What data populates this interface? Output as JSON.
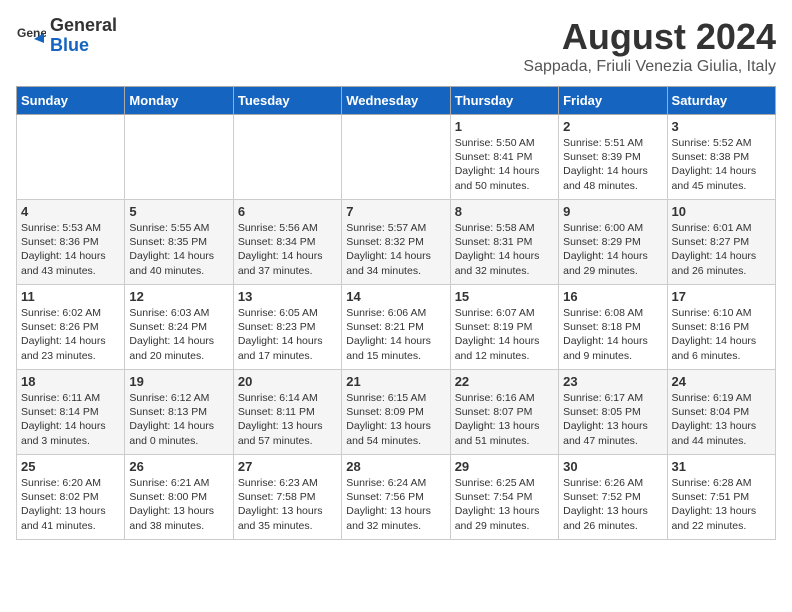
{
  "header": {
    "logo_line1": "General",
    "logo_line2": "Blue",
    "main_title": "August 2024",
    "subtitle": "Sappada, Friuli Venezia Giulia, Italy"
  },
  "days_of_week": [
    "Sunday",
    "Monday",
    "Tuesday",
    "Wednesday",
    "Thursday",
    "Friday",
    "Saturday"
  ],
  "weeks": [
    [
      {
        "day": "",
        "content": ""
      },
      {
        "day": "",
        "content": ""
      },
      {
        "day": "",
        "content": ""
      },
      {
        "day": "",
        "content": ""
      },
      {
        "day": "1",
        "content": "Sunrise: 5:50 AM\nSunset: 8:41 PM\nDaylight: 14 hours\nand 50 minutes."
      },
      {
        "day": "2",
        "content": "Sunrise: 5:51 AM\nSunset: 8:39 PM\nDaylight: 14 hours\nand 48 minutes."
      },
      {
        "day": "3",
        "content": "Sunrise: 5:52 AM\nSunset: 8:38 PM\nDaylight: 14 hours\nand 45 minutes."
      }
    ],
    [
      {
        "day": "4",
        "content": "Sunrise: 5:53 AM\nSunset: 8:36 PM\nDaylight: 14 hours\nand 43 minutes."
      },
      {
        "day": "5",
        "content": "Sunrise: 5:55 AM\nSunset: 8:35 PM\nDaylight: 14 hours\nand 40 minutes."
      },
      {
        "day": "6",
        "content": "Sunrise: 5:56 AM\nSunset: 8:34 PM\nDaylight: 14 hours\nand 37 minutes."
      },
      {
        "day": "7",
        "content": "Sunrise: 5:57 AM\nSunset: 8:32 PM\nDaylight: 14 hours\nand 34 minutes."
      },
      {
        "day": "8",
        "content": "Sunrise: 5:58 AM\nSunset: 8:31 PM\nDaylight: 14 hours\nand 32 minutes."
      },
      {
        "day": "9",
        "content": "Sunrise: 6:00 AM\nSunset: 8:29 PM\nDaylight: 14 hours\nand 29 minutes."
      },
      {
        "day": "10",
        "content": "Sunrise: 6:01 AM\nSunset: 8:27 PM\nDaylight: 14 hours\nand 26 minutes."
      }
    ],
    [
      {
        "day": "11",
        "content": "Sunrise: 6:02 AM\nSunset: 8:26 PM\nDaylight: 14 hours\nand 23 minutes."
      },
      {
        "day": "12",
        "content": "Sunrise: 6:03 AM\nSunset: 8:24 PM\nDaylight: 14 hours\nand 20 minutes."
      },
      {
        "day": "13",
        "content": "Sunrise: 6:05 AM\nSunset: 8:23 PM\nDaylight: 14 hours\nand 17 minutes."
      },
      {
        "day": "14",
        "content": "Sunrise: 6:06 AM\nSunset: 8:21 PM\nDaylight: 14 hours\nand 15 minutes."
      },
      {
        "day": "15",
        "content": "Sunrise: 6:07 AM\nSunset: 8:19 PM\nDaylight: 14 hours\nand 12 minutes."
      },
      {
        "day": "16",
        "content": "Sunrise: 6:08 AM\nSunset: 8:18 PM\nDaylight: 14 hours\nand 9 minutes."
      },
      {
        "day": "17",
        "content": "Sunrise: 6:10 AM\nSunset: 8:16 PM\nDaylight: 14 hours\nand 6 minutes."
      }
    ],
    [
      {
        "day": "18",
        "content": "Sunrise: 6:11 AM\nSunset: 8:14 PM\nDaylight: 14 hours\nand 3 minutes."
      },
      {
        "day": "19",
        "content": "Sunrise: 6:12 AM\nSunset: 8:13 PM\nDaylight: 14 hours\nand 0 minutes."
      },
      {
        "day": "20",
        "content": "Sunrise: 6:14 AM\nSunset: 8:11 PM\nDaylight: 13 hours\nand 57 minutes."
      },
      {
        "day": "21",
        "content": "Sunrise: 6:15 AM\nSunset: 8:09 PM\nDaylight: 13 hours\nand 54 minutes."
      },
      {
        "day": "22",
        "content": "Sunrise: 6:16 AM\nSunset: 8:07 PM\nDaylight: 13 hours\nand 51 minutes."
      },
      {
        "day": "23",
        "content": "Sunrise: 6:17 AM\nSunset: 8:05 PM\nDaylight: 13 hours\nand 47 minutes."
      },
      {
        "day": "24",
        "content": "Sunrise: 6:19 AM\nSunset: 8:04 PM\nDaylight: 13 hours\nand 44 minutes."
      }
    ],
    [
      {
        "day": "25",
        "content": "Sunrise: 6:20 AM\nSunset: 8:02 PM\nDaylight: 13 hours\nand 41 minutes."
      },
      {
        "day": "26",
        "content": "Sunrise: 6:21 AM\nSunset: 8:00 PM\nDaylight: 13 hours\nand 38 minutes."
      },
      {
        "day": "27",
        "content": "Sunrise: 6:23 AM\nSunset: 7:58 PM\nDaylight: 13 hours\nand 35 minutes."
      },
      {
        "day": "28",
        "content": "Sunrise: 6:24 AM\nSunset: 7:56 PM\nDaylight: 13 hours\nand 32 minutes."
      },
      {
        "day": "29",
        "content": "Sunrise: 6:25 AM\nSunset: 7:54 PM\nDaylight: 13 hours\nand 29 minutes."
      },
      {
        "day": "30",
        "content": "Sunrise: 6:26 AM\nSunset: 7:52 PM\nDaylight: 13 hours\nand 26 minutes."
      },
      {
        "day": "31",
        "content": "Sunrise: 6:28 AM\nSunset: 7:51 PM\nDaylight: 13 hours\nand 22 minutes."
      }
    ]
  ]
}
